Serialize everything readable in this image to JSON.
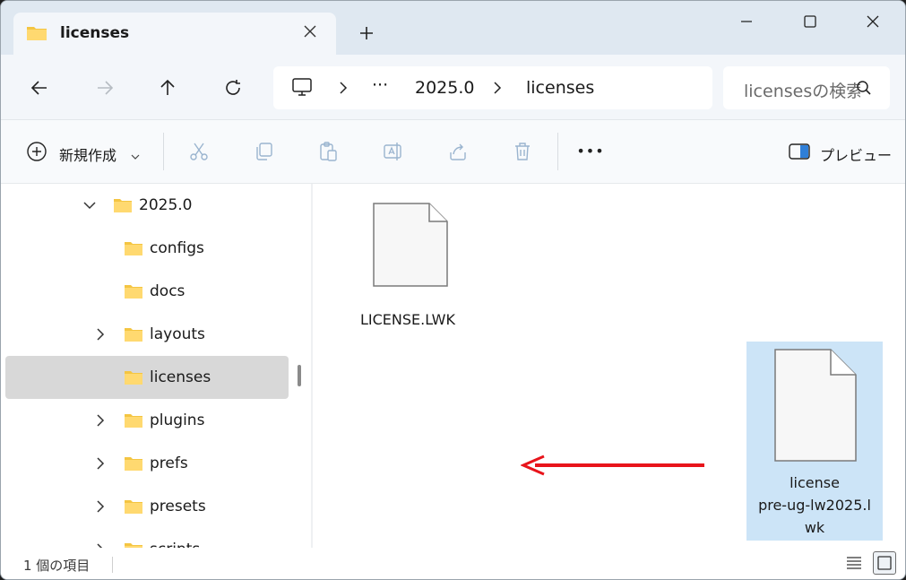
{
  "tab": {
    "title": "licenses"
  },
  "breadcrumb": {
    "ellipsis": "···",
    "items": [
      "2025.0",
      "licenses"
    ]
  },
  "search": {
    "placeholder": "licensesの検索"
  },
  "toolbar": {
    "new_label": "新規作成",
    "more_label": "•••",
    "preview_label": "プレビュー"
  },
  "tree": [
    {
      "label": "2025.0",
      "expanded": true
    },
    {
      "label": "configs"
    },
    {
      "label": "docs"
    },
    {
      "label": "layouts"
    },
    {
      "label": "licenses",
      "selected": true
    },
    {
      "label": "plugins"
    },
    {
      "label": "prefs"
    },
    {
      "label": "presets"
    },
    {
      "label": "scripts"
    }
  ],
  "files": [
    {
      "name": "LICENSE.LWK",
      "selected": false
    },
    {
      "name_lines": [
        "license",
        "pre-ug-lw2025.l",
        "wk"
      ],
      "selected": true
    }
  ],
  "annotation": {
    "color": "#e8141b"
  },
  "colors": {
    "accent": "#0067c0",
    "selection": "#cce4f7",
    "folder": "#f4c542"
  },
  "status": {
    "item_count": "1 個の項目"
  }
}
